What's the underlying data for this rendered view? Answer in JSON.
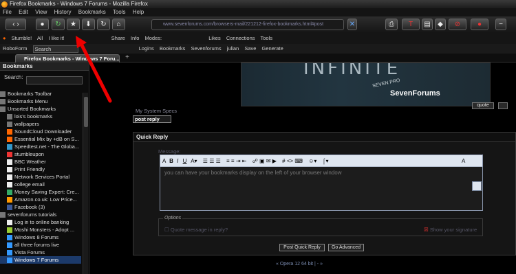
{
  "window": {
    "title": "Firefox Bookmarks - Windows 7 Forums - Mozilla Firefox"
  },
  "menu": [
    "File",
    "Edit",
    "View",
    "History",
    "Bookmarks",
    "Tools",
    "Help"
  ],
  "navbar": {
    "url": "www.sevenforums.com/browsers-mail/221212-firefox-bookmarks.html#post"
  },
  "toolbar2": {
    "stumble": "Stumble!",
    "all": "All",
    "ilike": "I like it!",
    "share": "Share",
    "info": "Info",
    "modes": "Modes:",
    "likes": "Likes",
    "connections": "Connections",
    "tools": "Tools"
  },
  "toolbar3": {
    "roboform": "RoboForm",
    "search": "Search",
    "logins": "Logins",
    "bookmarks": "Bookmarks",
    "sevenforums": "Sevenforums",
    "julian": "julian",
    "save": "Save",
    "generate": "Generate"
  },
  "tab": {
    "active": "Firefox Bookmarks - Windows 7 Foru...",
    "new": "+"
  },
  "sidebar": {
    "title": "Bookmarks",
    "search_label": "Search:",
    "items": [
      "Bookmarks Toolbar",
      "Bookmarks Menu",
      "Unsorted Bookmarks",
      "lois's bookmarks",
      "wallpapers",
      "SoundCloud Downloader",
      "Essential Mix by +dB on S...",
      "Speedtest.net - The Globa...",
      "stumbleupon",
      "BBC Weather",
      "Print Friendly",
      "Network Services Portal",
      "college email",
      "Money Saving Expert: Cre...",
      "Amazon.co.uk: Low Price...",
      "Facebook (3)",
      "sevenforums tutorials",
      "Log in to online banking",
      "Moshi Monsters - Adopt ...",
      "Windows 8 Forums",
      "all three forums live",
      "Vista Forums",
      "Windows 7 Forums"
    ]
  },
  "content": {
    "banner_word": "INFINITE",
    "banner_sub": "SEVEN PRO",
    "banner_logo": "SevenForums",
    "my_system_specs": "My System Specs",
    "quote": "quote",
    "post_reply": "post reply",
    "quick_reply": "Quick Reply",
    "message_label": "Message:",
    "editor_text": "you can have your bookmarks display on the left of your browser window",
    "options_legend": "Options",
    "quote_message": "Quote message in reply?",
    "show_signature": "Show your signature",
    "post_quick_reply": "Post Quick Reply",
    "go_advanced": "Go Advanced",
    "thread_nav": "« Opera 12 64 bit | - »"
  }
}
